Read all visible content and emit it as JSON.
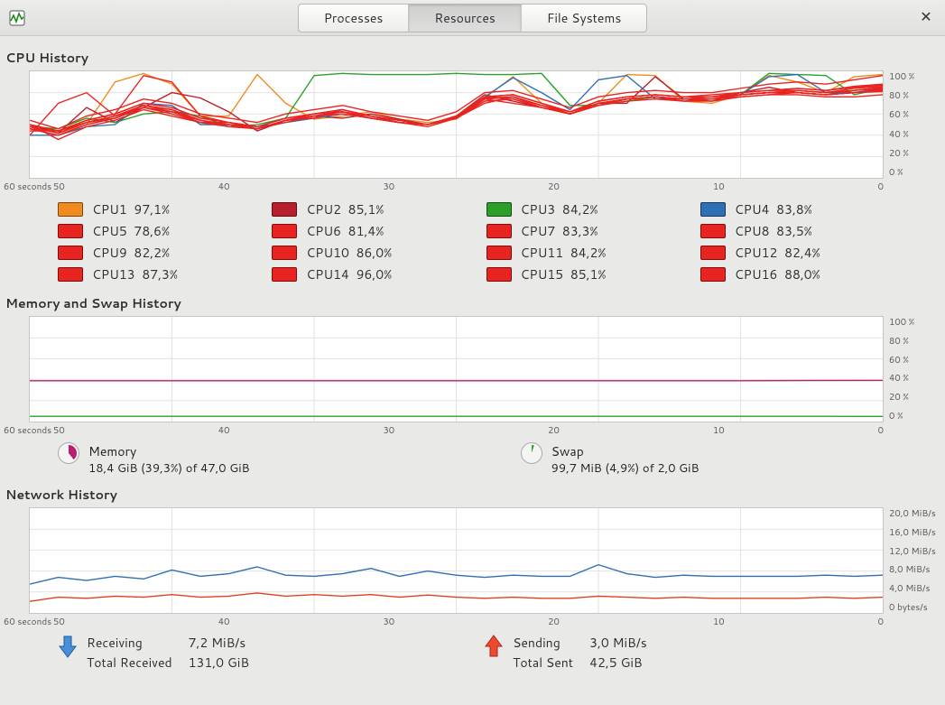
{
  "header": {
    "tabs": [
      "Processes",
      "Resources",
      "File Systems"
    ],
    "active_tab_index": 1
  },
  "sections": {
    "cpu_title": "CPU History",
    "mem_title": "Memory and Swap History",
    "net_title": "Network History"
  },
  "xaxis": {
    "left_label": "60 seconds",
    "ticks": [
      "50",
      "40",
      "30",
      "20",
      "10",
      "0"
    ]
  },
  "cpu": {
    "yaxis_ticks": [
      "100 %",
      "80 %",
      "60 %",
      "40 %",
      "20 %",
      "0 %"
    ],
    "legend": [
      {
        "name": "CPU1",
        "pct": "97,1%",
        "color": "#f08c1f"
      },
      {
        "name": "CPU2",
        "pct": "85,1%",
        "color": "#b81f2c"
      },
      {
        "name": "CPU3",
        "pct": "84,2%",
        "color": "#2aa02a"
      },
      {
        "name": "CPU4",
        "pct": "83,8%",
        "color": "#2f6fb3"
      },
      {
        "name": "CPU5",
        "pct": "78,6%",
        "color": "#e92420"
      },
      {
        "name": "CPU6",
        "pct": "81,4%",
        "color": "#e92420"
      },
      {
        "name": "CPU7",
        "pct": "83,3%",
        "color": "#e92420"
      },
      {
        "name": "CPU8",
        "pct": "83,5%",
        "color": "#e92420"
      },
      {
        "name": "CPU9",
        "pct": "82,2%",
        "color": "#e92420"
      },
      {
        "name": "CPU10",
        "pct": "86,0%",
        "color": "#e92420"
      },
      {
        "name": "CPU11",
        "pct": "84,2%",
        "color": "#e92420"
      },
      {
        "name": "CPU12",
        "pct": "82,4%",
        "color": "#e92420"
      },
      {
        "name": "CPU13",
        "pct": "87,3%",
        "color": "#e92420"
      },
      {
        "name": "CPU14",
        "pct": "96,0%",
        "color": "#e92420"
      },
      {
        "name": "CPU15",
        "pct": "85,1%",
        "color": "#e92420"
      },
      {
        "name": "CPU16",
        "pct": "88,0%",
        "color": "#e92420"
      }
    ]
  },
  "memory": {
    "yaxis_ticks": [
      "100 %",
      "80 %",
      "60 %",
      "40 %",
      "20 %",
      "0 %"
    ],
    "mem_label": "Memory",
    "mem_value": "18,4 GiB (39,3%) of 47,0 GiB",
    "mem_pct": 39.3,
    "mem_color": "#b81f6f",
    "swap_label": "Swap",
    "swap_value": "99,7 MiB (4,9%) of 2,0 GiB",
    "swap_pct": 4.9,
    "swap_color": "#2aa02a"
  },
  "network": {
    "yaxis_ticks": [
      "20,0 MiB/s",
      "16,0 MiB/s",
      "12,0 MiB/s",
      "8,0 MiB/s",
      "4,0 MiB/s",
      "0 bytes/s"
    ],
    "recv_label": "Receiving",
    "recv_value": "7,2 MiB/s",
    "recv_total_label": "Total Received",
    "recv_total_value": "131,0 GiB",
    "recv_color": "#2f6fb3",
    "send_label": "Sending",
    "send_value": "3,0 MiB/s",
    "send_total_label": "Total Sent",
    "send_total_value": "42,5 GiB",
    "send_color": "#e04020"
  },
  "chart_data": [
    {
      "type": "line",
      "title": "CPU History",
      "xlabel": "seconds",
      "ylabel": "%",
      "xlim": [
        60,
        0
      ],
      "ylim": [
        0,
        100
      ],
      "x": [
        60,
        58,
        56,
        54,
        52,
        50,
        48,
        46,
        44,
        42,
        40,
        38,
        36,
        34,
        32,
        30,
        28,
        26,
        24,
        22,
        20,
        18,
        16,
        14,
        12,
        10,
        8,
        6,
        4,
        2,
        0
      ],
      "series": [
        {
          "name": "CPU1",
          "color": "#f08c1f",
          "values": [
            48,
            42,
            50,
            90,
            98,
            88,
            58,
            58,
            97,
            70,
            55,
            58,
            62,
            55,
            52,
            55,
            75,
            95,
            70,
            60,
            70,
            97,
            96,
            72,
            70,
            78,
            96,
            90,
            80,
            95,
            97
          ]
        },
        {
          "name": "CPU2",
          "color": "#b81f2c",
          "values": [
            50,
            42,
            66,
            52,
            66,
            80,
            75,
            62,
            44,
            54,
            58,
            56,
            60,
            55,
            50,
            58,
            78,
            72,
            66,
            60,
            70,
            70,
            95,
            74,
            72,
            80,
            85,
            80,
            78,
            82,
            85
          ]
        },
        {
          "name": "CPU3",
          "color": "#2aa02a",
          "values": [
            48,
            46,
            56,
            52,
            60,
            62,
            58,
            48,
            50,
            56,
            96,
            98,
            97,
            97,
            97,
            98,
            97,
            97,
            98,
            68,
            68,
            72,
            76,
            74,
            76,
            78,
            98,
            97,
            96,
            78,
            84
          ]
        },
        {
          "name": "CPU4",
          "color": "#2f6fb3",
          "values": [
            40,
            40,
            48,
            50,
            70,
            68,
            50,
            50,
            48,
            52,
            56,
            60,
            56,
            52,
            50,
            56,
            76,
            94,
            80,
            64,
            92,
            96,
            74,
            74,
            76,
            78,
            95,
            97,
            80,
            80,
            84
          ]
        },
        {
          "name": "CPU5",
          "color": "#e92420",
          "values": [
            50,
            36,
            48,
            54,
            64,
            58,
            52,
            52,
            46,
            54,
            56,
            64,
            58,
            52,
            50,
            56,
            74,
            70,
            66,
            60,
            68,
            74,
            76,
            72,
            72,
            76,
            78,
            78,
            76,
            76,
            78
          ]
        },
        {
          "name": "CPU6",
          "color": "#e92420",
          "values": [
            40,
            70,
            80,
            58,
            66,
            60,
            52,
            48,
            46,
            52,
            58,
            62,
            56,
            52,
            48,
            56,
            70,
            76,
            66,
            60,
            68,
            72,
            74,
            72,
            74,
            76,
            78,
            80,
            78,
            80,
            81
          ]
        },
        {
          "name": "CPU7",
          "color": "#e92420",
          "values": [
            44,
            44,
            52,
            56,
            68,
            62,
            52,
            50,
            46,
            54,
            58,
            62,
            56,
            52,
            50,
            56,
            74,
            76,
            68,
            60,
            70,
            74,
            76,
            74,
            74,
            78,
            80,
            80,
            78,
            80,
            83
          ]
        },
        {
          "name": "CPU8",
          "color": "#e92420",
          "values": [
            46,
            44,
            52,
            58,
            68,
            64,
            54,
            50,
            46,
            54,
            60,
            62,
            58,
            52,
            50,
            56,
            74,
            76,
            68,
            62,
            70,
            74,
            76,
            74,
            74,
            78,
            80,
            80,
            78,
            80,
            83
          ]
        },
        {
          "name": "CPU9",
          "color": "#e92420",
          "values": [
            46,
            40,
            50,
            56,
            66,
            62,
            54,
            50,
            46,
            54,
            58,
            60,
            56,
            52,
            50,
            56,
            72,
            74,
            66,
            60,
            68,
            74,
            76,
            74,
            74,
            78,
            80,
            80,
            78,
            80,
            82
          ]
        },
        {
          "name": "CPU10",
          "color": "#e92420",
          "values": [
            50,
            44,
            54,
            60,
            70,
            66,
            56,
            52,
            48,
            56,
            60,
            64,
            58,
            54,
            50,
            58,
            76,
            78,
            70,
            62,
            72,
            76,
            78,
            76,
            76,
            80,
            82,
            82,
            80,
            84,
            86
          ]
        },
        {
          "name": "CPU11",
          "color": "#e92420",
          "values": [
            48,
            42,
            52,
            58,
            68,
            64,
            54,
            50,
            46,
            54,
            58,
            62,
            56,
            52,
            50,
            56,
            74,
            76,
            68,
            60,
            70,
            74,
            76,
            74,
            74,
            78,
            80,
            82,
            80,
            82,
            84
          ]
        },
        {
          "name": "CPU12",
          "color": "#e92420",
          "values": [
            46,
            40,
            50,
            56,
            66,
            62,
            54,
            50,
            46,
            54,
            58,
            62,
            56,
            52,
            50,
            56,
            72,
            74,
            66,
            60,
            68,
            74,
            76,
            74,
            74,
            78,
            80,
            80,
            78,
            80,
            82
          ]
        },
        {
          "name": "CPU13",
          "color": "#e92420",
          "values": [
            50,
            44,
            54,
            60,
            96,
            90,
            58,
            52,
            48,
            56,
            60,
            64,
            58,
            54,
            50,
            58,
            76,
            78,
            70,
            62,
            72,
            76,
            78,
            76,
            76,
            80,
            82,
            84,
            82,
            85,
            87
          ]
        },
        {
          "name": "CPU14",
          "color": "#e92420",
          "values": [
            54,
            46,
            58,
            64,
            74,
            70,
            60,
            56,
            52,
            60,
            64,
            68,
            62,
            58,
            54,
            62,
            80,
            82,
            74,
            66,
            76,
            80,
            82,
            80,
            80,
            84,
            88,
            90,
            88,
            92,
            96
          ]
        },
        {
          "name": "CPU15",
          "color": "#e92420",
          "values": [
            48,
            42,
            52,
            58,
            68,
            64,
            54,
            50,
            46,
            54,
            58,
            62,
            56,
            52,
            50,
            57,
            75,
            76,
            68,
            60,
            70,
            74,
            76,
            74,
            76,
            78,
            80,
            82,
            80,
            82,
            85
          ]
        },
        {
          "name": "CPU16",
          "color": "#e92420",
          "values": [
            50,
            44,
            54,
            60,
            70,
            66,
            56,
            52,
            48,
            56,
            60,
            64,
            58,
            54,
            50,
            58,
            76,
            78,
            70,
            62,
            72,
            76,
            78,
            76,
            78,
            80,
            82,
            84,
            82,
            86,
            88
          ]
        }
      ]
    },
    {
      "type": "line",
      "title": "Memory and Swap History",
      "xlabel": "seconds",
      "ylabel": "%",
      "xlim": [
        60,
        0
      ],
      "ylim": [
        0,
        100
      ],
      "x": [
        60,
        50,
        40,
        30,
        20,
        10,
        0
      ],
      "series": [
        {
          "name": "Memory",
          "color": "#b81f6f",
          "values": [
            39,
            39,
            39,
            39,
            39,
            39,
            39.3
          ]
        },
        {
          "name": "Swap",
          "color": "#2aa02a",
          "values": [
            5,
            5,
            5,
            5,
            5,
            5,
            4.9
          ]
        }
      ]
    },
    {
      "type": "line",
      "title": "Network History",
      "xlabel": "seconds",
      "ylabel": "MiB/s",
      "xlim": [
        60,
        0
      ],
      "ylim": [
        0,
        20
      ],
      "x": [
        60,
        58,
        56,
        54,
        52,
        50,
        48,
        46,
        44,
        42,
        40,
        38,
        36,
        34,
        32,
        30,
        28,
        26,
        24,
        22,
        20,
        18,
        16,
        14,
        12,
        10,
        8,
        6,
        4,
        2,
        0
      ],
      "series": [
        {
          "name": "Receiving",
          "color": "#2f6fb3",
          "values": [
            5.5,
            6.8,
            6.2,
            7.0,
            6.5,
            8.2,
            7.0,
            7.5,
            8.8,
            7.2,
            7.0,
            7.5,
            8.5,
            7.0,
            8.0,
            7.2,
            6.8,
            7.2,
            7.0,
            7.0,
            9.2,
            7.5,
            6.8,
            7.2,
            7.0,
            7.0,
            7.0,
            7.0,
            7.2,
            7.0,
            7.2
          ]
        },
        {
          "name": "Sending",
          "color": "#e04020",
          "values": [
            2.2,
            3.0,
            2.8,
            3.2,
            3.0,
            3.5,
            3.0,
            3.2,
            3.8,
            3.2,
            3.5,
            3.2,
            3.5,
            3.0,
            3.4,
            3.0,
            2.8,
            3.0,
            2.8,
            2.8,
            3.2,
            3.0,
            2.8,
            3.0,
            2.8,
            2.8,
            2.8,
            2.8,
            3.0,
            2.8,
            3.0
          ]
        }
      ]
    }
  ]
}
